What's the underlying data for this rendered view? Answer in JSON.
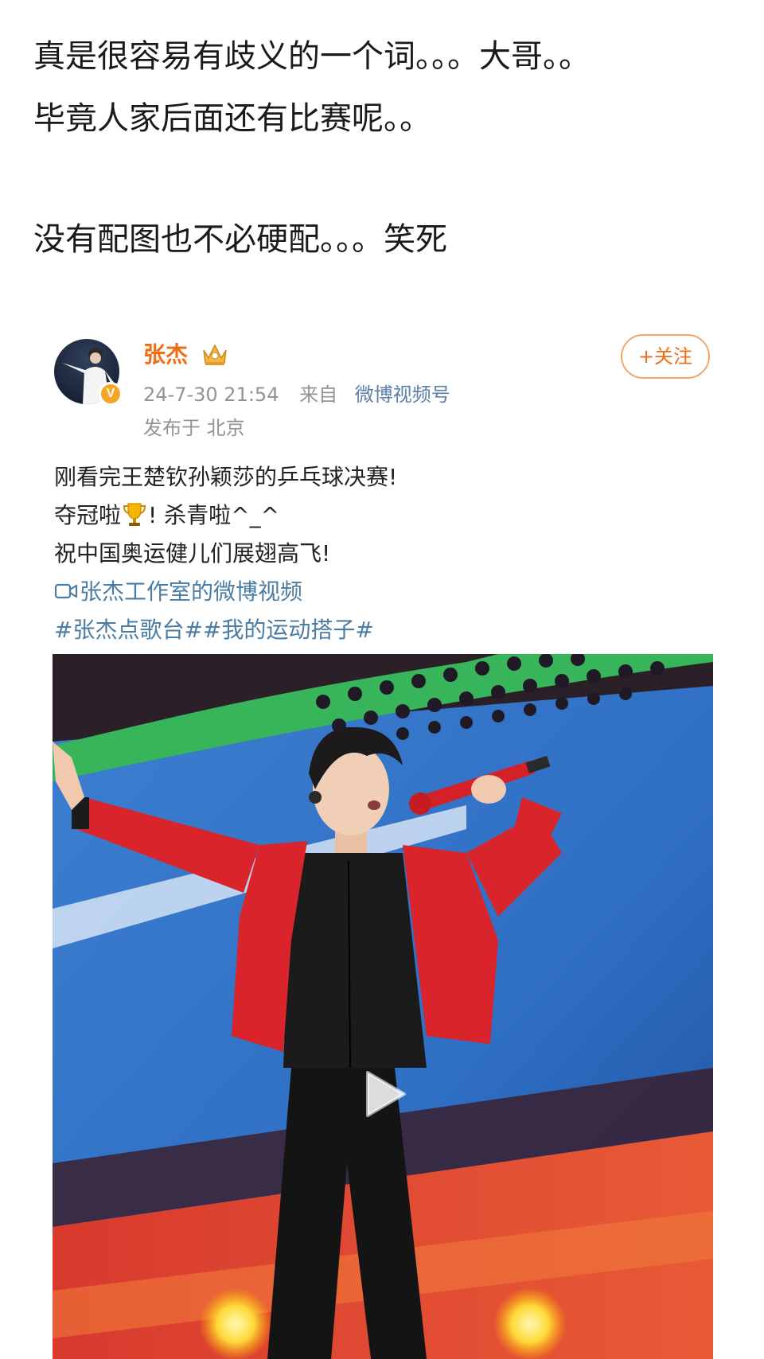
{
  "commentary": {
    "line1": "真是很容易有歧义的一个词。。。大哥。。",
    "line2": "毕竟人家后面还有比赛呢。。",
    "line3": "没有配图也不必硬配。。。笑死"
  },
  "post": {
    "username": "张杰",
    "verified_badge": "V",
    "follow_label": "+关注",
    "timestamp": "24-7-30 21:54",
    "from_label": "来自",
    "source": "微博视频号",
    "location": "发布于 北京",
    "body": {
      "line1": "刚看完王楚钦孙颖莎的乒乓球决赛!",
      "line2_before": "夺冠啦",
      "line2_after": "! 杀青啦^_^",
      "line3": "祝中国奥运健儿们展翅高飞!",
      "video_link": "张杰工作室的微博视频",
      "hashtags": "#张杰点歌台##我的运动搭子#"
    },
    "icons": {
      "crown": "crown-icon",
      "trophy": "trophy-icon",
      "video": "video-camera-icon",
      "play": "play-icon"
    },
    "colors": {
      "username": "#f26c13",
      "link": "#4b7ca3",
      "meta": "#939393"
    }
  }
}
